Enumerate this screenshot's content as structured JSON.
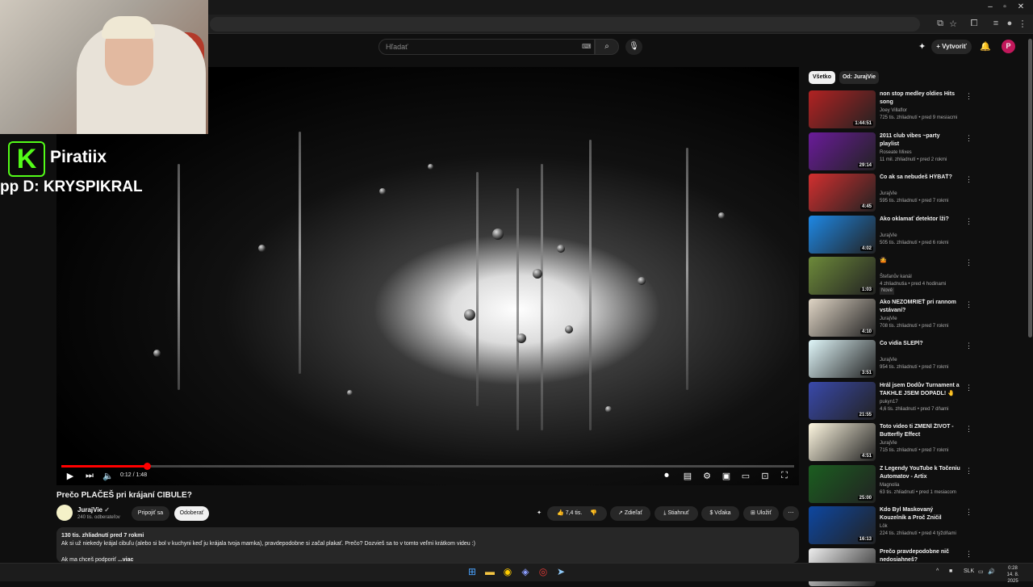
{
  "yt": {
    "search_placeholder": "Hľadať",
    "create_label": "Vytvoriť",
    "avatar_letter": "P"
  },
  "stream_overlay": {
    "brand_letter": "K",
    "name": "Piratiix",
    "drop": "pp D: KRYSPIKRAL"
  },
  "player": {
    "time": "0:12 / 1:48",
    "progress": 0.117,
    "buffered": 0.44
  },
  "video": {
    "title": "Prečo PLAČEŠ pri krájaní CIBULE?",
    "channel": "JurajVie",
    "subscribers": "240 tis. odberateľov",
    "join_label": "Pripojiť sa",
    "subscribe_label": "Odoberať",
    "likes": "7,4 tis.",
    "share_label": "Zdieľať",
    "download_label": "Stiahnuť",
    "thanks_label": "Vďaka",
    "save_label": "Uložiť"
  },
  "description": {
    "stats": "130 tis. zhliadnutí  pred 7 rokmi",
    "text": "Ak si už niekedy krájal cibuľu (alebo si bol v kuchyni keď ju krájala tvoja mamka), pravdepodobne si začal plakať. Prečo? Dozvieš sa to v tomto veľmi krátkom videu :)",
    "more_line": "Ak ma chceš podporiť",
    "more_label": "...viac"
  },
  "filter_chips": [
    "Všetko",
    "Od: JurajVie"
  ],
  "recommendations": [
    {
      "title": "non stop medley oldies Hits song",
      "channel": "Joey Villaflor",
      "views": "725 tis. zhliadnutí • pred 9 mesiacmi",
      "duration": "1:44:51",
      "color": "#b22222"
    },
    {
      "title": "2011 club vibes ~party playlist",
      "channel": "Roseate Mixes",
      "views": "11 mil. zhliadnutí • pred 2 rokmi",
      "duration": "29:14",
      "color": "#6a1b9a"
    },
    {
      "title": "Čo ak sa nebudeš HÝBAŤ?",
      "channel": "JurajVie",
      "views": "595 tis. zhliadnutí • pred 7 rokmi",
      "duration": "4:45",
      "color": "#d32f2f"
    },
    {
      "title": "Ako oklamať detektor lži?",
      "channel": "JurajVie",
      "views": "505 tis. zhliadnutí • pred 6 rokmi",
      "duration": "4:02",
      "color": "#1e88e5"
    },
    {
      "title": "🤷",
      "channel": "Štefanův kanál",
      "views": "4 zhliadnutia • pred 4 hodinami",
      "badge": "Nové",
      "duration": "1:03",
      "color": "#6d8a3a"
    },
    {
      "title": "Ako NEZOMRIEŤ pri rannom vstávaní?",
      "channel": "JurajVie",
      "views": "708 tis. zhliadnutí • pred 7 rokmi",
      "duration": "4:10",
      "color": "#e0d5c5"
    },
    {
      "title": "Čo vidia SLEPÍ?",
      "channel": "JurajVie",
      "views": "954 tis. zhliadnutí • pred 7 rokmi",
      "duration": "3:51",
      "color": "#e0f7fa"
    },
    {
      "title": "Hrál jsem Dodův Turnament a TAKHLE JSEM DOPADL! 🤚 ...",
      "channel": "pukyn17",
      "views": "4,6 tis. zhliadnutí • pred 7 dňami",
      "duration": "21:55",
      "color": "#3949ab"
    },
    {
      "title": "Toto video ti ZMENÍ ŽIVOT - Butterfly Effect",
      "channel": "JurajVie",
      "views": "715 tis. zhliadnutí • pred 7 rokmi",
      "duration": "4:51",
      "color": "#fff8e1"
    },
    {
      "title": "Z Legendy YouTube k Točeniu Automatov - Artix",
      "channel": "Magnolia",
      "views": "63 tis. zhliadnutí • pred 1 mesiacom",
      "duration": "25:00",
      "color": "#1b5e20"
    },
    {
      "title": "Kdo Byl Maskovaný Kouzelník a Proč Zničil Magii?",
      "channel": "Lök",
      "views": "224 tis. zhliadnutí • pred 4 týždňami",
      "duration": "16:13",
      "color": "#0d47a1"
    },
    {
      "title": "Prečo pravdepodobne nič nedosiahneš?",
      "channel": "",
      "views": "",
      "duration": "",
      "color": "#eeeeee"
    }
  ],
  "taskbar": {
    "lang": "SLK",
    "time": "0:28",
    "date": "14. 8. 2025"
  }
}
